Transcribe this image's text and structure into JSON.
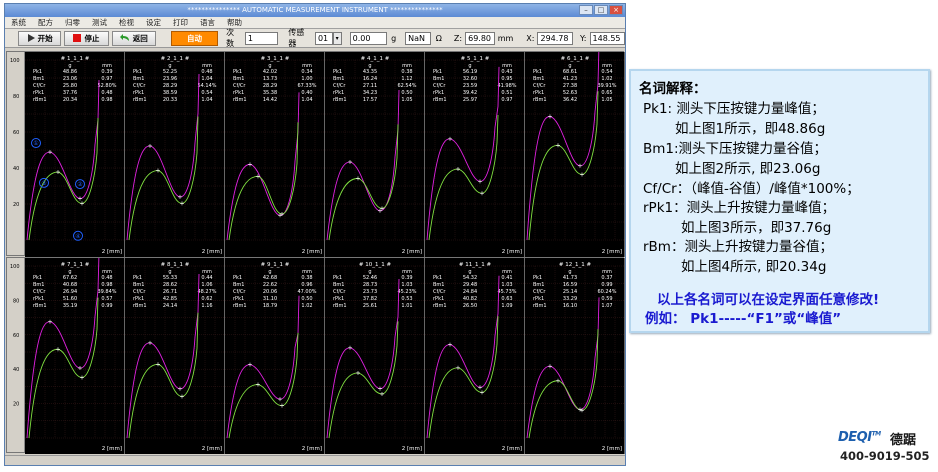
{
  "window": {
    "title": "*************** AUTOMATIC MEASUREMENT INSTRUMENT ***************"
  },
  "menu": [
    "系统",
    "配方",
    "归零",
    "测试",
    "检视",
    "设定",
    "打印",
    "语言",
    "帮助"
  ],
  "toolbar": {
    "start": "开始",
    "stop": "停止",
    "back": "返回",
    "auto": "自动",
    "count_label": "次数",
    "count_value": "1",
    "sensor_label": "传感器",
    "sensor_value": "01",
    "force_value": "0.00",
    "force_unit": "g",
    "nan_value": "NaN",
    "ohm_unit": "Ω",
    "z_label": "Z:",
    "z_value": "69.80",
    "z_unit": "mm",
    "x_label": "X:",
    "x_value": "294.78",
    "y_label": "Y:",
    "y_value": "148.55"
  },
  "axis": {
    "ymax": "100",
    "ticks": [
      "80",
      "60",
      "40",
      "20"
    ],
    "x_label": "2 [mm]"
  },
  "columns": {
    "unit1": "g",
    "unit2": "mm"
  },
  "row_labels": [
    "Pk1",
    "Bm1",
    "Cf/Cr",
    "rPk1",
    "rBm1"
  ],
  "markers": [
    "①",
    "②",
    "③",
    "④"
  ],
  "panels": [
    {
      "title": "# 1_1_1 #",
      "values": [
        [
          "48.86",
          "0.39"
        ],
        [
          "23.06",
          "0.97"
        ],
        [
          "25.80",
          "52.80%"
        ],
        [
          "37.76",
          "0.48"
        ],
        [
          "20.34",
          "0.98"
        ]
      ],
      "curve": {
        "pk": 48.86,
        "bm": 23.06,
        "rpk": 37.76,
        "rbm": 20.34
      }
    },
    {
      "title": "# 2_1_1 #",
      "values": [
        [
          "52.25",
          "0.48"
        ],
        [
          "23.96",
          "1.04"
        ],
        [
          "28.29",
          "54.14%"
        ],
        [
          "38.59",
          "0.54"
        ],
        [
          "20.33",
          "1.04"
        ]
      ],
      "curve": {
        "pk": 52.25,
        "bm": 23.96,
        "rpk": 38.59,
        "rbm": 20.33
      }
    },
    {
      "title": "# 3_1_1 #",
      "values": [
        [
          "42.02",
          "0.34"
        ],
        [
          "13.73",
          "1.00"
        ],
        [
          "28.29",
          "67.33%"
        ],
        [
          "35.38",
          "0.40"
        ],
        [
          "14.42",
          "1.04"
        ]
      ],
      "curve": {
        "pk": 42.02,
        "bm": 13.73,
        "rpk": 35.38,
        "rbm": 14.42
      }
    },
    {
      "title": "# 4_1_1 #",
      "values": [
        [
          "43.35",
          "0.38"
        ],
        [
          "16.24",
          "1.12"
        ],
        [
          "27.11",
          "62.54%"
        ],
        [
          "34.23",
          "0.50"
        ],
        [
          "17.57",
          "1.05"
        ]
      ],
      "curve": {
        "pk": 43.35,
        "bm": 16.24,
        "rpk": 34.23,
        "rbm": 17.57
      }
    },
    {
      "title": "# 5_1_1 #",
      "values": [
        [
          "56.19",
          "0.43"
        ],
        [
          "32.60",
          "0.95"
        ],
        [
          "23.59",
          "41.98%"
        ],
        [
          "39.42",
          "0.51"
        ],
        [
          "25.97",
          "0.97"
        ]
      ],
      "curve": {
        "pk": 56.19,
        "bm": 32.6,
        "rpk": 39.42,
        "rbm": 25.97
      }
    },
    {
      "title": "# 6_1_1 #",
      "values": [
        [
          "68.61",
          "0.54"
        ],
        [
          "41.23",
          "1.02"
        ],
        [
          "27.38",
          "39.91%"
        ],
        [
          "52.63",
          "0.65"
        ],
        [
          "36.42",
          "1.05"
        ]
      ],
      "curve": {
        "pk": 68.61,
        "bm": 41.23,
        "rpk": 52.63,
        "rbm": 36.42
      }
    },
    {
      "title": "# 7_1_1 #",
      "values": [
        [
          "67.62",
          "0.48"
        ],
        [
          "40.68",
          "0.98"
        ],
        [
          "26.94",
          "39.84%"
        ],
        [
          "51.60",
          "0.57"
        ],
        [
          "35.19",
          "0.99"
        ]
      ],
      "curve": {
        "pk": 67.62,
        "bm": 40.68,
        "rpk": 51.6,
        "rbm": 35.19
      }
    },
    {
      "title": "# 8_1_1 #",
      "values": [
        [
          "55.33",
          "0.44"
        ],
        [
          "28.62",
          "1.06"
        ],
        [
          "26.71",
          "48.27%"
        ],
        [
          "42.85",
          "0.62"
        ],
        [
          "24.14",
          "1.16"
        ]
      ],
      "curve": {
        "pk": 55.33,
        "bm": 28.62,
        "rpk": 42.85,
        "rbm": 24.14
      }
    },
    {
      "title": "# 9_1_1 #",
      "values": [
        [
          "42.68",
          "0.38"
        ],
        [
          "22.62",
          "0.96"
        ],
        [
          "20.06",
          "47.00%"
        ],
        [
          "31.10",
          "0.50"
        ],
        [
          "18.79",
          "1.02"
        ]
      ],
      "curve": {
        "pk": 42.68,
        "bm": 22.62,
        "rpk": 31.1,
        "rbm": 18.79
      }
    },
    {
      "title": "# 10_1_1 #",
      "values": [
        [
          "52.46",
          "0.39"
        ],
        [
          "28.73",
          "1.03"
        ],
        [
          "23.73",
          "45.23%"
        ],
        [
          "37.82",
          "0.53"
        ],
        [
          "25.61",
          "1.01"
        ]
      ],
      "curve": {
        "pk": 52.46,
        "bm": 28.73,
        "rpk": 37.82,
        "rbm": 25.61
      }
    },
    {
      "title": "# 11_1_1 #",
      "values": [
        [
          "54.32",
          "0.41"
        ],
        [
          "29.48",
          "1.03"
        ],
        [
          "24.84",
          "45.73%"
        ],
        [
          "40.82",
          "0.63"
        ],
        [
          "26.50",
          "1.09"
        ]
      ],
      "curve": {
        "pk": 54.32,
        "bm": 29.48,
        "rpk": 40.82,
        "rbm": 26.5
      }
    },
    {
      "title": "# 12_1_1 #",
      "values": [
        [
          "41.73",
          "0.37"
        ],
        [
          "16.59",
          "0.99"
        ],
        [
          "25.14",
          "60.24%"
        ],
        [
          "33.29",
          "0.59"
        ],
        [
          "16.10",
          "1.07"
        ]
      ],
      "curve": {
        "pk": 41.73,
        "bm": 16.59,
        "rpk": 33.29,
        "rbm": 16.1
      }
    }
  ],
  "explanation": {
    "heading": "名词解释：",
    "lines": [
      "Pk1: 测头下压按键力量峰值；",
      "如上图1所示，即48.86g",
      "Bm1:测头下压按键力量谷值；",
      "如上图2所示, 即23.06g",
      "Cf/Cr：（峰值-谷值）/峰值*100%；",
      "rPk1：测头上升按键力量峰值；",
      "如上图3所示，即37.76g",
      "rBm：测头上升按键力量谷值；",
      "如上图4所示, 即20.34g"
    ],
    "note1": "以上各名词可以在设定界面任意修改!",
    "note2": "例如： Pk1-----“F1”或“峰值”"
  },
  "logo": {
    "word": "DEQI",
    "tm": "TM",
    "cn": "德踞",
    "phone": "400-9019-505"
  },
  "colors": {
    "press": "#e020e0",
    "release": "#80e040",
    "marker": "#2060ff",
    "accent": "#ff8a00"
  }
}
